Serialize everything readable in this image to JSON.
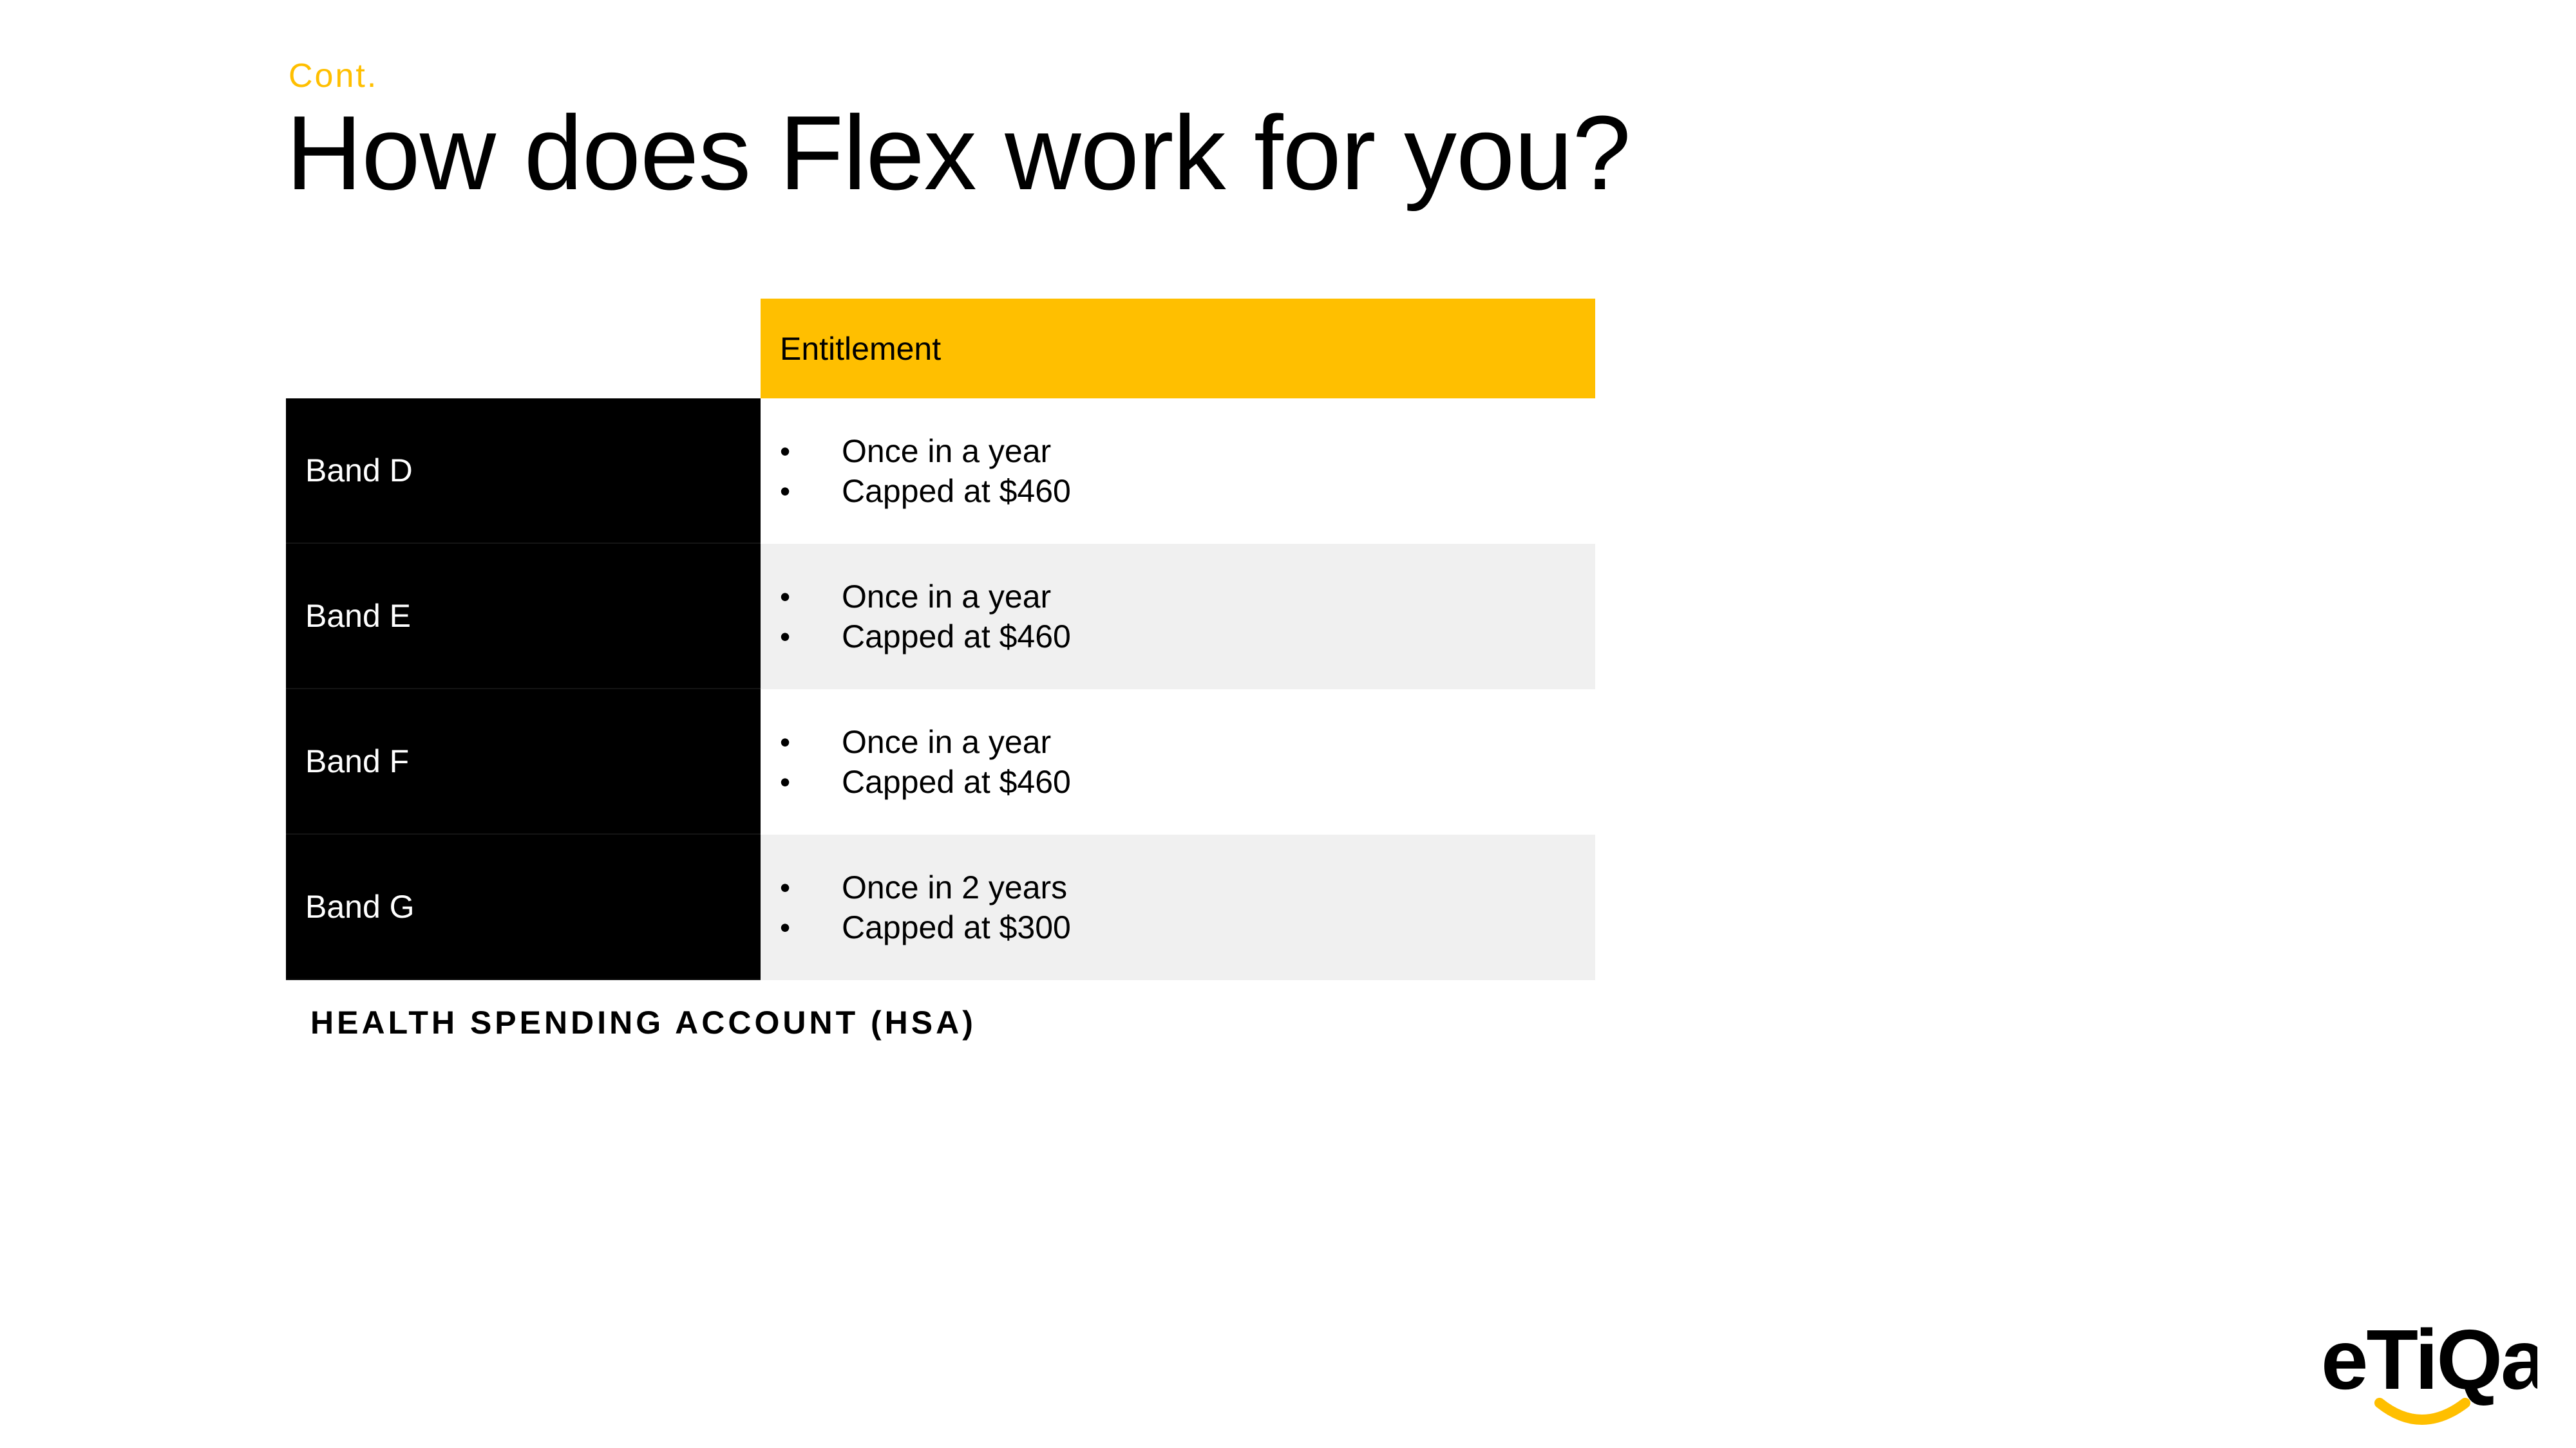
{
  "slide": {
    "subtitle": "Cont.",
    "title": "How does Flex work for you?",
    "footer_label": "HEALTH SPENDING ACCOUNT (HSA)"
  },
  "table": {
    "header": "Entitlement",
    "rows": [
      {
        "band": "Band D",
        "lines": [
          "Once in a year",
          "Capped at $460"
        ]
      },
      {
        "band": "Band E",
        "lines": [
          "Once in a year",
          "Capped at $460"
        ]
      },
      {
        "band": "Band F",
        "lines": [
          "Once in a year",
          "Capped at $460"
        ]
      },
      {
        "band": "Band G",
        "lines": [
          "Once in 2 years",
          "Capped at $300"
        ]
      }
    ],
    "bullet": "•"
  },
  "logo": {
    "text": "eTiQa",
    "icon": "etiqa-logo-icon"
  },
  "colors": {
    "accent": "#FFBF00",
    "band_bg": "#000000",
    "alt_row_bg": "#F0F0F0",
    "text": "#000000"
  }
}
